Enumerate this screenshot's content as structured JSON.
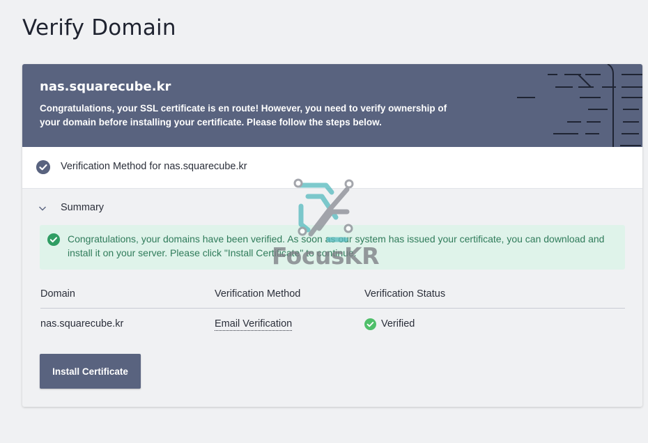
{
  "page": {
    "title": "Verify Domain"
  },
  "banner": {
    "domain": "nas.squarecube.kr",
    "message": "Congratulations, your SSL certificate is en route! However, you need to verify ownership of your domain before installing your certificate. Please follow the steps below."
  },
  "verification": {
    "method_label": "Verification Method for nas.squarecube.kr"
  },
  "summary": {
    "label": "Summary",
    "alert": "Congratulations, your domains have been verified. As soon as our system has issued your certificate, you can download and install it on your server. Please click \"Install Certificate\" to continue."
  },
  "table": {
    "headers": [
      "Domain",
      "Verification Method",
      "Verification Status"
    ],
    "rows": [
      {
        "domain": "nas.squarecube.kr",
        "method": "Email Verification",
        "status": "Verified"
      }
    ]
  },
  "actions": {
    "install_label": "Install Certificate"
  },
  "watermark": {
    "text": "FocusKR"
  },
  "colors": {
    "primary": "#59637f",
    "success": "#4fbf6a",
    "alert_bg": "#dff3ea",
    "alert_text": "#2f7b5a"
  }
}
